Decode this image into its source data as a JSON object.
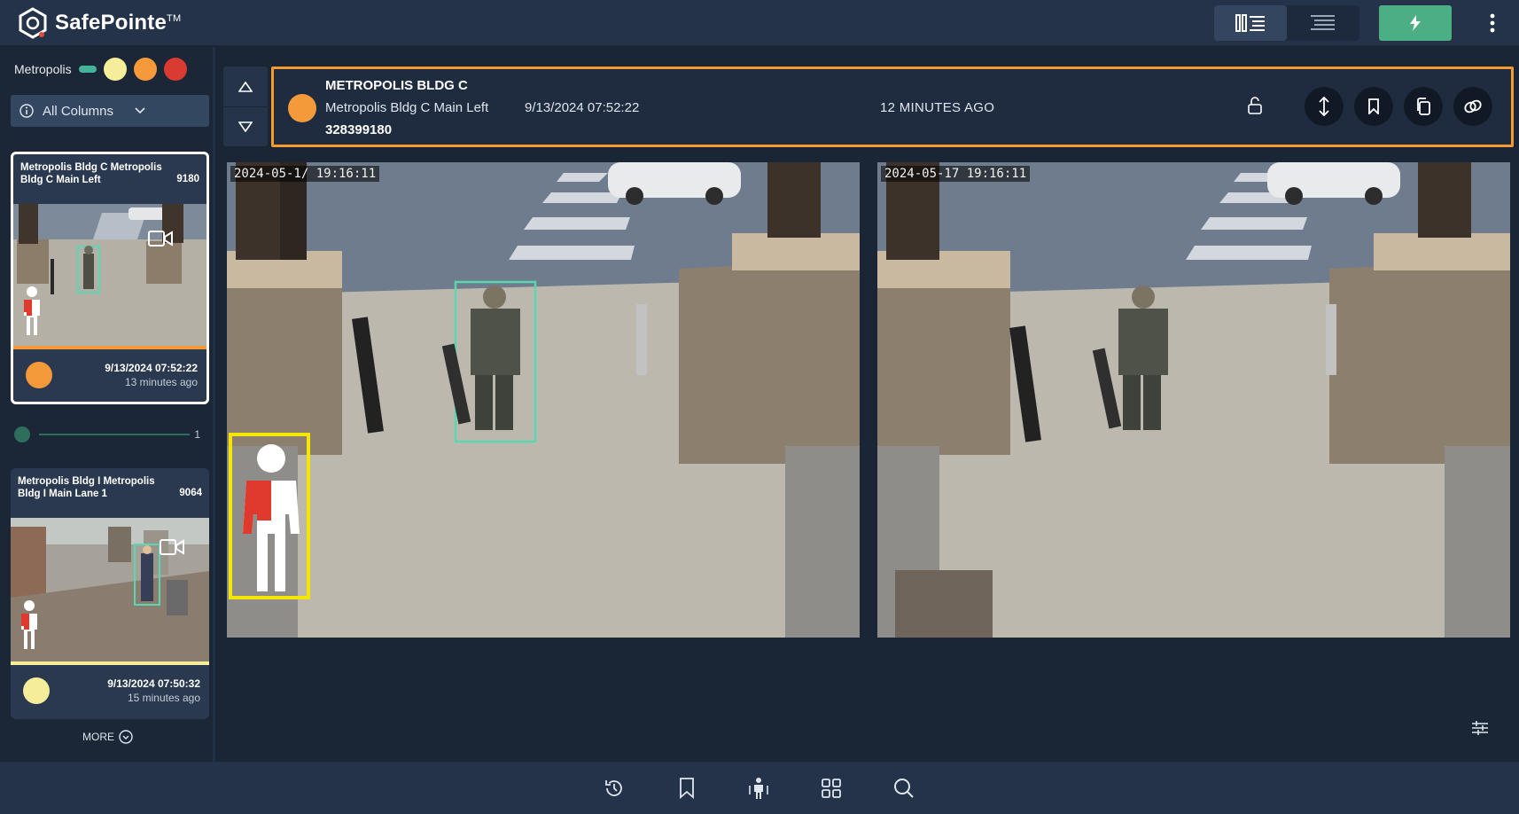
{
  "app": {
    "brand": "SafePointe",
    "brand_tm": "TM"
  },
  "header": {
    "views": [
      {
        "name": "grid-list-view",
        "active": true
      },
      {
        "name": "list-view",
        "active": false
      }
    ],
    "alert_button_icon": "bolt-icon",
    "menu_icon": "kebab-icon"
  },
  "sidebar": {
    "location": "Metropolis",
    "legend_colors": [
      "#45b39a",
      "#f5ed9a",
      "#f59a3a",
      "#d93a32"
    ],
    "column_filter": "All Columns",
    "cards": [
      {
        "title": "Metropolis Bldg C Metropolis Bldg C Main Left",
        "code": "9180",
        "severity_color": "#f59a3a",
        "time": "9/13/2024 07:52:22",
        "ago": "13 minutes ago",
        "selected": true
      },
      {
        "title": "Metropolis Bldg I Metropolis Bldg I Main Lane 1",
        "code": "9064",
        "severity_color": "#f5ed9a",
        "time": "9/13/2024 07:50:32",
        "ago": "15 minutes ago",
        "selected": false
      }
    ],
    "slider": {
      "value": "1"
    },
    "more_label": "MORE"
  },
  "event": {
    "title": "METROPOLIS BLDG C",
    "camera": "Metropolis Bldg C Main Left",
    "timestamp": "9/13/2024 07:52:22",
    "id": "328399180",
    "ago": "12 MINUTES AGO",
    "severity_color": "#f59a3a",
    "actions": [
      "swap-vertical-icon",
      "bookmark-icon",
      "copy-icon",
      "link-icon"
    ]
  },
  "frames": [
    {
      "timestamp": "2024-05-1/ 19:16:11",
      "annotated": true
    },
    {
      "timestamp": "2024-05-17 19:16:11",
      "annotated": false
    }
  ],
  "bottom_nav": [
    "history-icon",
    "bookmark-icon",
    "person-scan-icon",
    "grid-icon",
    "search-icon"
  ]
}
